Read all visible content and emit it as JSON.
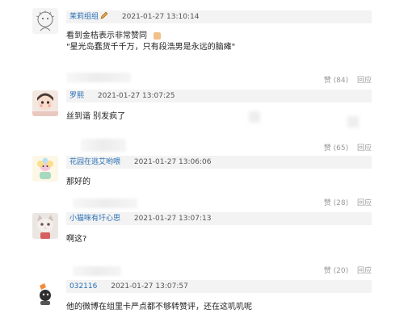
{
  "comments": [
    {
      "username": "茉莉组组",
      "timestamp": "2021-01-27 13:10:14",
      "lines": [
        "看到金桔表示非常赞同",
        "\"星光岛蠢货千千万，只有段浩男是永远的脑瘫\""
      ],
      "likes": "",
      "reply": ""
    },
    {
      "username": "罗熙",
      "timestamp": "2021-01-27 13:07:25",
      "lines": [
        "丝到谐 别发疯了"
      ],
      "likes": "赞 (84)",
      "reply": "回应"
    },
    {
      "username": "花园在逃艾哟喂",
      "timestamp": "2021-01-27 13:06:06",
      "lines": [
        "那好的"
      ],
      "likes": "赞 (65)",
      "reply": "回应"
    },
    {
      "username": "小猫咪有圩心思",
      "timestamp": "2021-01-27 13:07:13",
      "lines": [
        "啊这?"
      ],
      "likes": "赞 (28)",
      "reply": "回应"
    },
    {
      "username": "032116",
      "timestamp": "2021-01-27 13:07:57",
      "lines": [
        "他的微博在组里卡严点都不够转赞评，还在这叽叽呢"
      ],
      "likes": "赞 (20)",
      "reply": "回应"
    }
  ]
}
